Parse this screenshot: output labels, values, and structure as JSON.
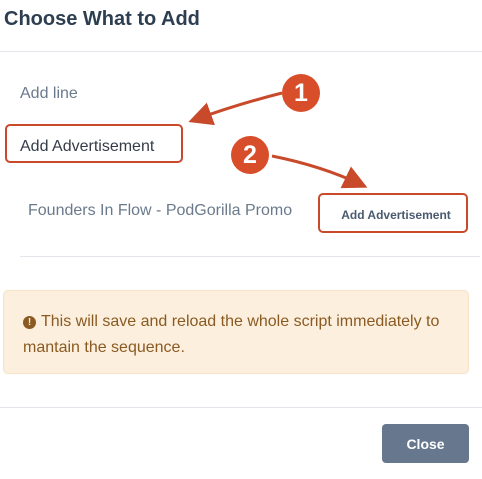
{
  "dialog": {
    "title": "Choose What to Add"
  },
  "options": {
    "add_line": "Add line",
    "add_advertisement": "Add Advertisement"
  },
  "advertisement": {
    "name": "Founders In Flow - PodGorilla Promo",
    "button_label": "Add Advertisement"
  },
  "alert": {
    "icon": "info-icon",
    "text": "This will save and reload the whole script immediately to mantain the sequence."
  },
  "footer": {
    "close_label": "Close"
  },
  "annotations": {
    "step1": "1",
    "step2": "2",
    "color": "#d94e2a"
  }
}
